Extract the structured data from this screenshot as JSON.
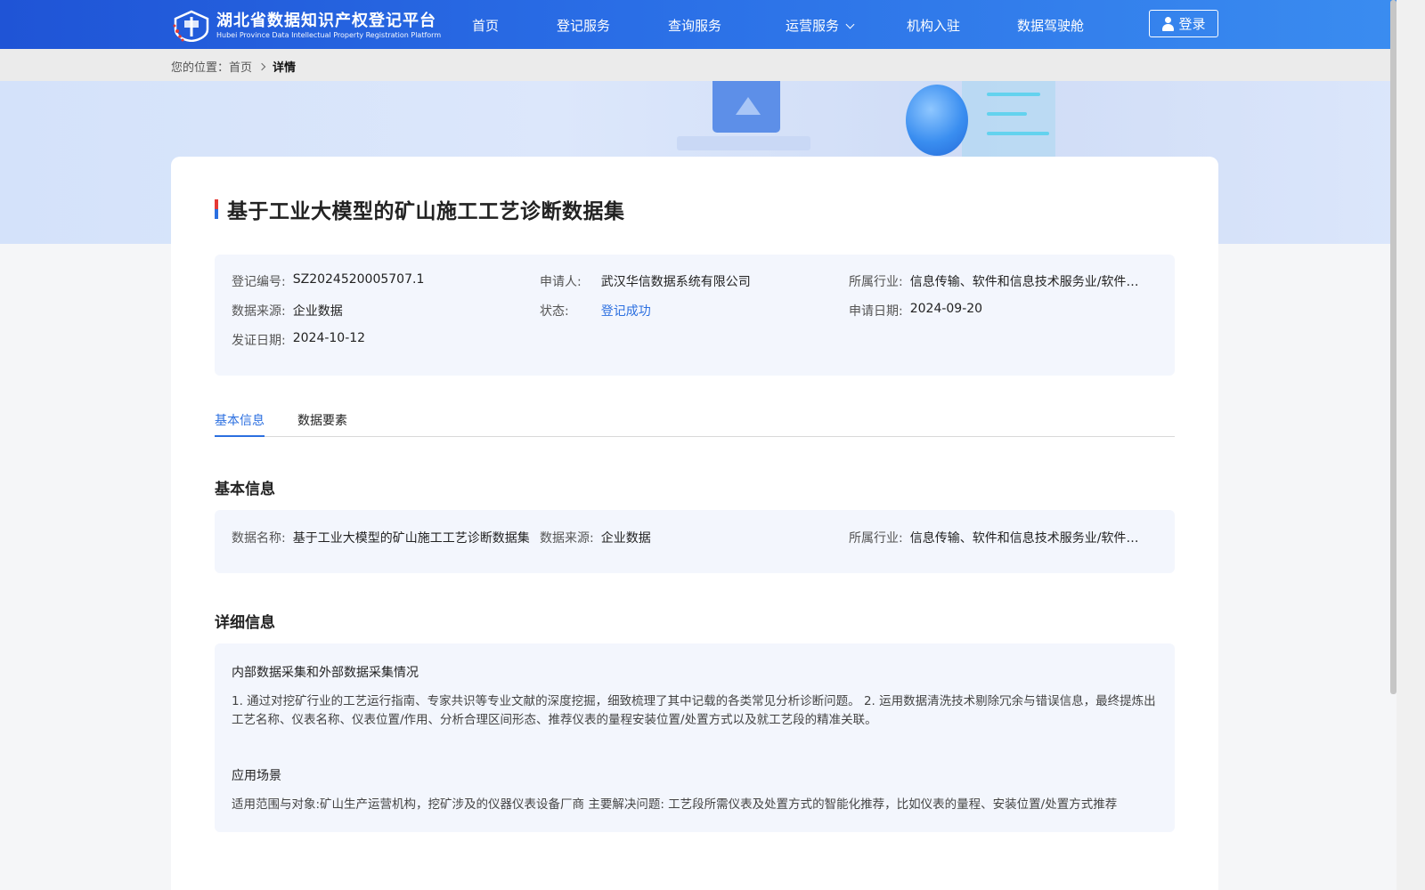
{
  "header": {
    "logo_cn": "湖北省数据知识产权登记平台",
    "logo_en": "Hubei Province Data Intellectual Property Registration Platform",
    "nav": [
      "首页",
      "登记服务",
      "查询服务",
      "运营服务",
      "机构入驻",
      "数据驾驶舱"
    ],
    "login_label": "登录",
    "colors": {
      "accent": "#2b6fe0",
      "header_start": "#1f54d6",
      "header_end": "#3a8cf0"
    }
  },
  "breadcrumb": {
    "prefix": "您的位置：",
    "home": "首页",
    "current": "详情"
  },
  "record": {
    "title": "基于工业大模型的矿山施工工艺诊断数据集",
    "summary": {
      "reg_no_label": "登记编号:",
      "reg_no": "SZ2024520005707.1",
      "applicant_label": "申请人:",
      "applicant": "武汉华信数据系统有限公司",
      "industry_label": "所属行业:",
      "industry": "信息传输、软件和信息技术服务业/软件和信息技术服务业",
      "source_label": "数据来源:",
      "source": "企业数据",
      "status_label": "状态:",
      "status": "登记成功",
      "apply_date_label": "申请日期:",
      "apply_date": "2024-09-20",
      "issue_date_label": "发证日期:",
      "issue_date": "2024-10-12"
    }
  },
  "tabs": [
    "基本信息",
    "数据要素"
  ],
  "basic": {
    "section_title": "基本信息",
    "name_label": "数据名称:",
    "name": "基于工业大模型的矿山施工工艺诊断数据集",
    "source_label": "数据来源:",
    "source": "企业数据",
    "industry_label": "所属行业:",
    "industry": "信息传输、软件和信息技术服务业/软件和信息技术服务业"
  },
  "detail": {
    "section_title": "详细信息",
    "collect_title": "内部数据采集和外部数据采集情况",
    "collect_text": "1. 通过对挖矿行业的工艺运行指南、专家共识等专业文献的深度挖掘，细致梳理了其中记载的各类常见分析诊断问题。 2. 运用数据清洗技术剔除冗余与错误信息，最终提炼出工艺名称、仪表名称、仪表位置/作用、分析合理区间形态、推荐仪表的量程安装位置/处置方式以及就工艺段的精准关联。",
    "scene_title": "应用场景",
    "scene_text": "适用范围与对象:矿山生产运营机构，挖矿涉及的仪器仪表设备厂商 主要解决问题: 工艺段所需仪表及处置方式的智能化推荐，比如仪表的量程、安装位置/处置方式推荐"
  }
}
